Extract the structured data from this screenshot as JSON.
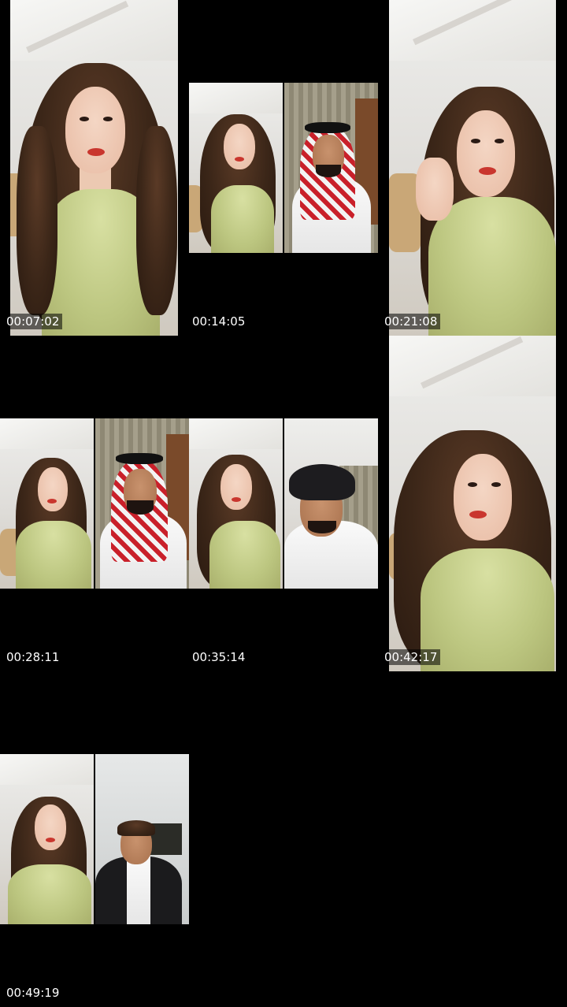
{
  "sheet": {
    "timestamps": [
      "00:07:02",
      "00:14:05",
      "00:21:08",
      "00:28:11",
      "00:35:14",
      "00:42:17",
      "00:49:19"
    ]
  },
  "colors": {
    "background": "#000000",
    "timestamp_text": "#ffffff"
  }
}
